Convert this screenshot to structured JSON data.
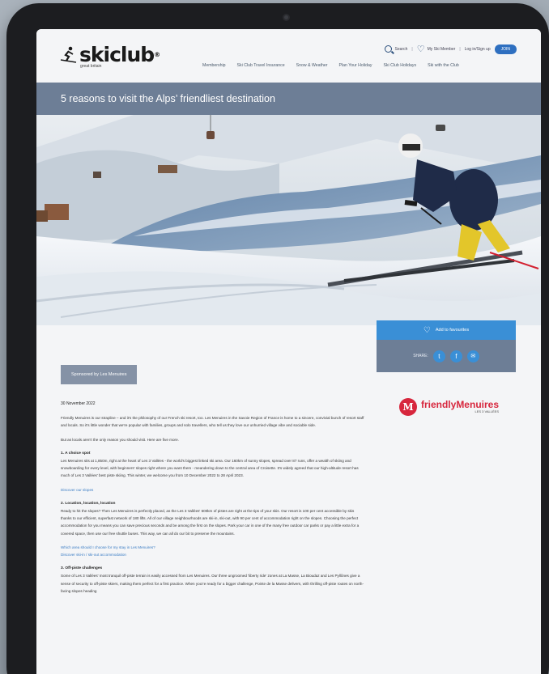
{
  "brand": {
    "name": "skiclub",
    "reg": "®",
    "sub": "great britain"
  },
  "util": {
    "search": "Search",
    "account": "My Ski Member",
    "login": "Log in/Sign up",
    "join": "JOIN"
  },
  "nav": [
    "Membership",
    "Ski Club Travel Insurance",
    "Snow & Weather",
    "Plan Your Holiday",
    "Ski Club Holidays",
    "Ski with the Club"
  ],
  "title": "5 reasons to visit the Alps’ friendliest destination",
  "sidecard": {
    "favourite": "Add to favourites",
    "share": "SHARE:"
  },
  "sponsor": "Sponsored by Les Menuires",
  "partner": {
    "mark": "M",
    "name_a": "friendly",
    "name_b": "Menuires",
    "sub": "LES 3 VALLÉES"
  },
  "article": {
    "date": "30 November 2022",
    "intro": "Friendly Menuires is our strapline – and it's the philosophy of our French ski resort, too. Les Menuires in the Savoie Region of France is home to a sincere, convivial bunch of resort staff and locals. So it's little wonder that we're popular with families, groups and solo travellers, who tell us they love our unhurried village vibe and sociable side.",
    "intro2": "But as locals aren't the only reason you should visit. Here are five more.",
    "s1_title": "1. A choice spot",
    "s1_body": "Les Menuires sits at 1,850m, right at the heart of Les 3 Vallées - the world's biggest linked ski area. Our 160km of sunny slopes, spread over 87 runs, offer a wealth of skiing and snowboarding for every level, with beginners' slopes right where you want them - meandering down to the central area of Croisette. It's widely agreed that our high-altitude resort has much of Les 3 Vallées' best piste skiing. This winter, we welcome you from 10 December 2022 to 28 April 2023.",
    "s1_link": "Discover our slopes",
    "s2_title": "2. Location, location, location",
    "s2_body": "Ready to hit the slopes? Then Les Menuires is perfectly placed, as the Les 3 Vallées' 600km of pistes are right at the tips of your skis. Our resort is 100 per cent accessible by skis thanks to our efficient, superfast network of 180 lifts. All of our village neighbourhoods are ski-in, ski-out, with 90 per cent of accommodation right on the slopes. Choosing the perfect accommodation for you means you can save precious seconds and be among the first on the slopes. Park your car in one of the many free outdoor car parks or pay a little extra for a covered space, then use our free shuttle buses. This way, we can all do our bit to preserve the mountains.",
    "s2_link1": "Which area should I choose for my stay in Les Menuires?",
    "s2_link2": "Discover ski-in / ski-out accommodation",
    "s3_title": "3. Off-piste challenges",
    "s3_body": "Some of Les 3 Vallées' most tranquil off-piste terrain is easily accessed from Les Menuires. Our three ungroomed 'liberty ride' zones at La Masse, La Bioudaz and Les Pyllônes give a sense of security to off-piste skiers, making them perfect for a first practice. When you're ready for a bigger challenge, Pointe de la Masse delivers, with thrilling off-piste routes on north-facing slopes heading"
  },
  "colors": {
    "band": "#6d7e96",
    "accent": "#3a8fd6",
    "brand_red": "#d7263d"
  }
}
